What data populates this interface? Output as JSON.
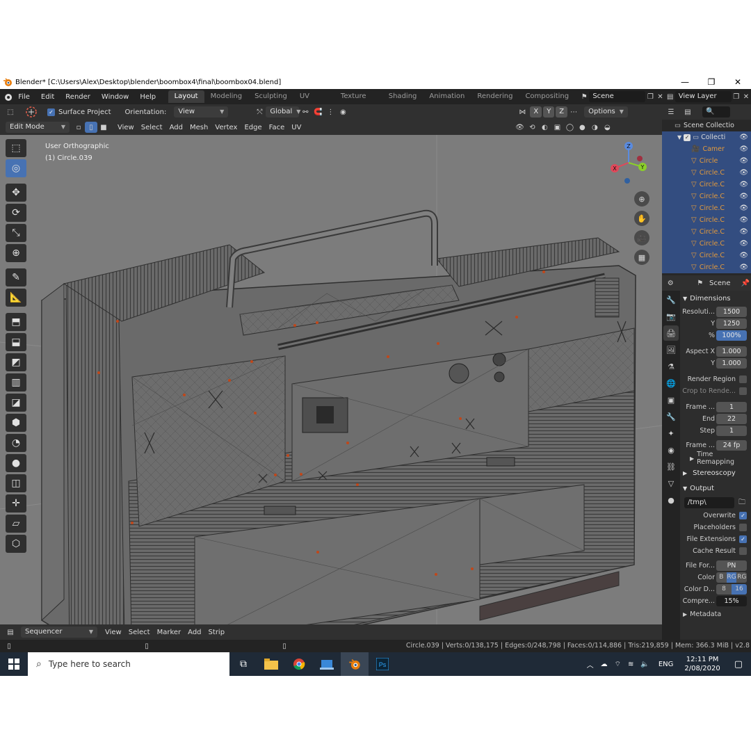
{
  "window": {
    "title": "Blender* [C:\\Users\\Alex\\Desktop\\blender\\boombox4\\final\\boombox04.blend]",
    "minimize": "—",
    "maximize": "❐",
    "close": "✕"
  },
  "menus": [
    "File",
    "Edit",
    "Render",
    "Window",
    "Help"
  ],
  "workspaces": [
    "Layout",
    "Modeling",
    "Sculpting",
    "UV Editing",
    "Texture Paint",
    "Shading",
    "Animation",
    "Rendering",
    "Compositing"
  ],
  "scene_name": "Scene",
  "view_layer": "View Layer",
  "tool_header": {
    "surface_project": "Surface Project",
    "orientation_label": "Orientation:",
    "orientation_value": "View",
    "transform_orientation": "Global",
    "options": "Options",
    "axis_x": "X",
    "axis_y": "Y",
    "axis_z": "Z"
  },
  "editor_header": {
    "mode": "Edit Mode",
    "menus": [
      "View",
      "Select",
      "Add",
      "Mesh",
      "Vertex",
      "Edge",
      "Face",
      "UV"
    ]
  },
  "viewport": {
    "projection": "User Orthographic",
    "object": "(1) Circle.039",
    "gizmo_x": "X",
    "gizmo_y": "Y",
    "gizmo_z": "Z"
  },
  "outliner": {
    "root": "Scene Collectio",
    "collection": "Collecti",
    "items": [
      "Camer",
      "Circle",
      "Circle.C",
      "Circle.C",
      "Circle.C",
      "Circle.C",
      "Circle.C",
      "Circle.C",
      "Circle.C",
      "Circle.C",
      "Circle.C"
    ]
  },
  "properties": {
    "context": "Scene",
    "dimensions": "Dimensions",
    "resolution_label": "Resoluti...",
    "res_x": "1500",
    "y_label": "Y",
    "res_y": "1250",
    "pct_label": "%",
    "res_pct": "100%",
    "aspect_label": "Aspect X",
    "aspect_x": "1.000",
    "aspect_y": "1.000",
    "render_region": "Render Region",
    "crop": "Crop to Rende...",
    "frame_start_label": "Frame ...",
    "frame_start": "1",
    "end_label": "End",
    "frame_end": "22",
    "step_label": "Step",
    "frame_step": "1",
    "frame_rate_label": "Frame ...",
    "frame_rate": "24 fp",
    "time_remapping": "Time Remapping",
    "stereoscopy": "Stereoscopy",
    "output": "Output",
    "output_path": "/tmp\\",
    "overwrite": "Overwrite",
    "placeholders": "Placeholders",
    "file_extensions": "File Extensions",
    "cache_result": "Cache Result",
    "file_format_label": "File For...",
    "file_format": "PN",
    "color_label": "Color",
    "color_b": "B",
    "color_rg": "RG",
    "color_rgb": "RG",
    "color_depth_label": "Color D...",
    "depth_8": "8",
    "depth_16": "16",
    "compression_label": "Compre...",
    "compression": "15%",
    "metadata": "Metadata"
  },
  "sequencer": {
    "editor": "Sequencer",
    "menus": [
      "View",
      "Select",
      "Marker",
      "Add",
      "Strip"
    ]
  },
  "status_bar": {
    "stats": "Circle.039 | Verts:0/138,175 | Edges:0/248,798 | Faces:0/114,886 | Tris:219,859 | Mem: 366.3 MiB | v2.8"
  },
  "taskbar": {
    "search_placeholder": "Type here to search",
    "language": "ENG",
    "time": "12:11 PM",
    "date": "2/08/2020"
  },
  "colors": {
    "accent": "#4772b3",
    "orange": "#e39a3c",
    "viewport_bg": "#7c7c7c",
    "panel_bg": "#2d2d2d"
  }
}
